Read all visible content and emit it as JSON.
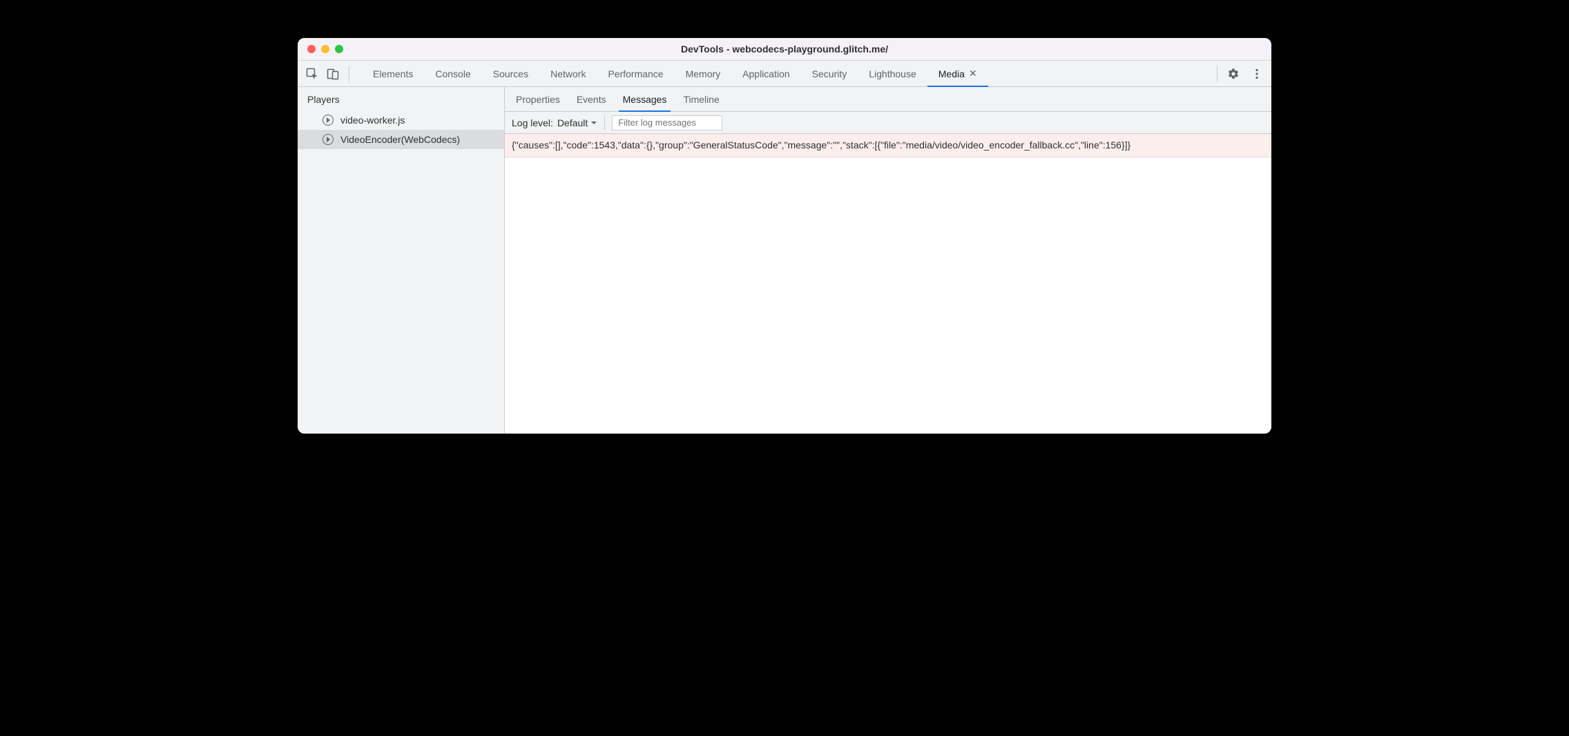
{
  "window": {
    "title": "DevTools - webcodecs-playground.glitch.me/"
  },
  "top_tabs": [
    {
      "label": "Elements",
      "active": false
    },
    {
      "label": "Console",
      "active": false
    },
    {
      "label": "Sources",
      "active": false
    },
    {
      "label": "Network",
      "active": false
    },
    {
      "label": "Performance",
      "active": false
    },
    {
      "label": "Memory",
      "active": false
    },
    {
      "label": "Application",
      "active": false
    },
    {
      "label": "Security",
      "active": false
    },
    {
      "label": "Lighthouse",
      "active": false
    },
    {
      "label": "Media",
      "active": true,
      "closable": true
    }
  ],
  "sidebar": {
    "header": "Players",
    "players": [
      {
        "label": "video-worker.js",
        "selected": false
      },
      {
        "label": "VideoEncoder(WebCodecs)",
        "selected": true
      }
    ]
  },
  "sub_tabs": [
    {
      "label": "Properties",
      "active": false
    },
    {
      "label": "Events",
      "active": false
    },
    {
      "label": "Messages",
      "active": true
    },
    {
      "label": "Timeline",
      "active": false
    }
  ],
  "filterbar": {
    "loglevel_label": "Log level:",
    "loglevel_value": "Default",
    "filter_placeholder": "Filter log messages"
  },
  "messages": [
    {
      "text": "{\"causes\":[],\"code\":1543,\"data\":{},\"group\":\"GeneralStatusCode\",\"message\":\"\",\"stack\":[{\"file\":\"media/video/video_encoder_fallback.cc\",\"line\":156}]}"
    }
  ]
}
